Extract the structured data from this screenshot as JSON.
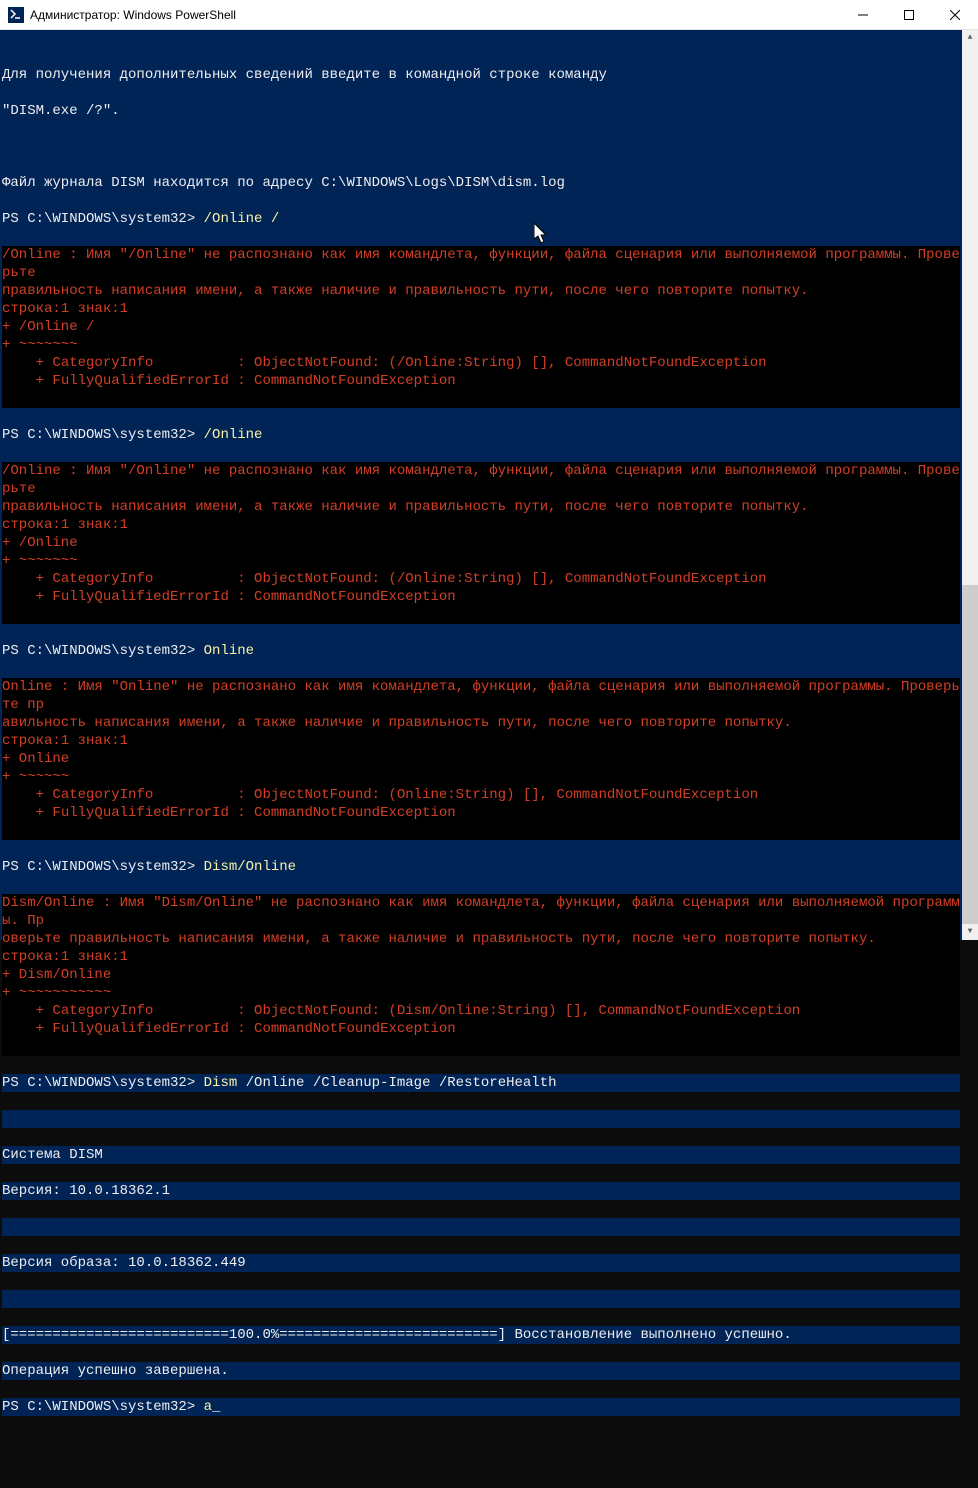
{
  "titlebar": {
    "icon_name": "powershell-icon",
    "title": "Администратор: Windows PowerShell"
  },
  "info": {
    "help_line": "Для получения дополнительных сведений введите в командной строке команду",
    "help_cmd": "\"DISM.exe /?\".",
    "log_line": "Файл журнала DISM находится по адресу C:\\WINDOWS\\Logs\\DISM\\dism.log"
  },
  "prompt": "PS C:\\WINDOWS\\system32> ",
  "blocks": [
    {
      "cmd": "/Online /",
      "err1": "/Online : Имя \"/Online\" не распознано как имя командлета, функции, файла сценария или выполняемой программы. Проверьте",
      "err2": "правильность написания имени, а также наличие и правильность пути, после чего повторите попытку.",
      "pos": "строка:1 знак:1",
      "echo": "+ /Online /",
      "tilde": "+ ~~~~~~~",
      "cat": "    + CategoryInfo          : ObjectNotFound: (/Online:String) [], CommandNotFoundException",
      "fqi": "    + FullyQualifiedErrorId : CommandNotFoundException"
    },
    {
      "cmd": "/Online",
      "err1": "/Online : Имя \"/Online\" не распознано как имя командлета, функции, файла сценария или выполняемой программы. Проверьте",
      "err2": "правильность написания имени, а также наличие и правильность пути, после чего повторите попытку.",
      "pos": "строка:1 знак:1",
      "echo": "+ /Online",
      "tilde": "+ ~~~~~~~",
      "cat": "    + CategoryInfo          : ObjectNotFound: (/Online:String) [], CommandNotFoundException",
      "fqi": "    + FullyQualifiedErrorId : CommandNotFoundException"
    },
    {
      "cmd": "Online",
      "err1": "Online : Имя \"Online\" не распознано как имя командлета, функции, файла сценария или выполняемой программы. Проверьте пр",
      "err2": "авильность написания имени, а также наличие и правильность пути, после чего повторите попытку.",
      "pos": "строка:1 знак:1",
      "echo": "+ Online",
      "tilde": "+ ~~~~~~",
      "cat": "    + CategoryInfo          : ObjectNotFound: (Online:String) [], CommandNotFoundException",
      "fqi": "    + FullyQualifiedErrorId : CommandNotFoundException"
    },
    {
      "cmd": "Dism/Online",
      "err1": "Dism/Online : Имя \"Dism/Online\" не распознано как имя командлета, функции, файла сценария или выполняемой программы. Пр",
      "err2": "оверьте правильность написания имени, а также наличие и правильность пути, после чего повторите попытку.",
      "pos": "строка:1 знак:1",
      "echo": "+ Dism/Online",
      "tilde": "+ ~~~~~~~~~~~",
      "cat": "    + CategoryInfo          : ObjectNotFound: (Dism/Online:String) [], CommandNotFoundException",
      "fqi": "    + FullyQualifiedErrorId : CommandNotFoundException"
    }
  ],
  "final": {
    "cmd_dism": "Dism",
    "cmd_args": " /Online /Cleanup-Image /RestoreHealth",
    "sys": "Система DISM",
    "ver": "Версия: 10.0.18362.1",
    "img_ver": "Версия образа: 10.0.18362.449",
    "progress": "[==========================100.0%==========================] Восстановление выполнено успешно.",
    "done": "Операция успешно завершена.",
    "input": "a",
    "caret": "_"
  }
}
